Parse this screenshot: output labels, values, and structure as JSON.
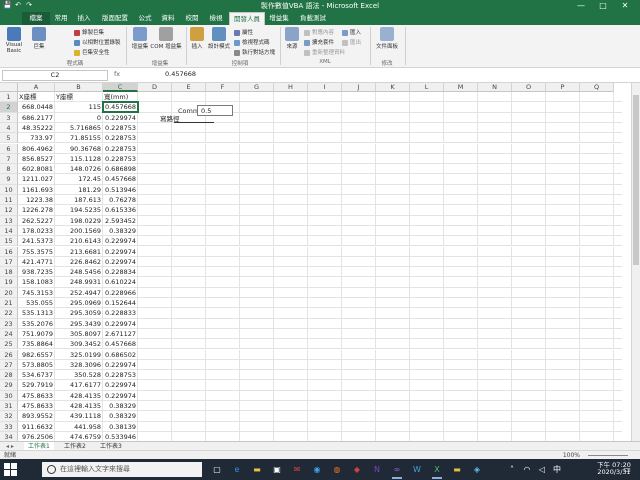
{
  "window": {
    "title": "製作數值VBA 語法 - Microsoft Excel",
    "controls": [
      "—",
      "□",
      "✕"
    ],
    "qat": [
      "💾",
      "↶",
      "↷"
    ]
  },
  "ribbon_tabs": [
    "檔案",
    "常用",
    "插入",
    "版面配置",
    "公式",
    "資料",
    "校閱",
    "檢視",
    "開發人員",
    "增益集",
    "負載測試"
  ],
  "ribbon": {
    "code_group": {
      "label": "程式碼",
      "visual_basic": "Visual Basic",
      "macros": "巨集",
      "record_macro": "錄製巨集",
      "relative_refs": "以相對位置錄製",
      "macro_security": "巨集安全性"
    },
    "addins_group": {
      "label": "增益集",
      "addins": "增益集",
      "com_addins": "COM 增益集"
    },
    "controls_group": {
      "label": "控制項",
      "insert": "插入",
      "design_mode": "設計模式",
      "properties": "屬性",
      "view_code": "檢視程式碼",
      "run_dialog": "執行對話方塊"
    },
    "xml_group": {
      "label": "XML",
      "source": "來源",
      "map_props": "對應內容",
      "expansion": "擴充套件",
      "refresh": "重新整理資料",
      "import": "匯入",
      "export": "匯出"
    },
    "modify_group": {
      "label": "修改",
      "doc_panel": "文件面板"
    }
  },
  "formula_bar": {
    "name_box": "C2",
    "fx": "fx",
    "formula": "0.457668"
  },
  "columns": [
    "A",
    "B",
    "C",
    "D",
    "E",
    "F",
    "G",
    "H",
    "I",
    "J",
    "K",
    "L",
    "M",
    "N",
    "O",
    "P",
    "Q"
  ],
  "rows": [
    {
      "n": "1",
      "a": "X座標",
      "b": "Y座標",
      "c": "寬(mm)"
    },
    {
      "n": "2",
      "a": "668.0448",
      "b": "115",
      "c": "0.457668"
    },
    {
      "n": "3",
      "a": "686.2177",
      "b": "0",
      "c": "0.229974"
    },
    {
      "n": "4",
      "a": "48.35222",
      "b": "5.716865",
      "c": "0.228753"
    },
    {
      "n": "5",
      "a": "733.97",
      "b": "71.85155",
      "c": "0.228753"
    },
    {
      "n": "6",
      "a": "806.4962",
      "b": "90.36768",
      "c": "0.228753"
    },
    {
      "n": "7",
      "a": "856.8527",
      "b": "115.1128",
      "c": "0.228753"
    },
    {
      "n": "8",
      "a": "602.8081",
      "b": "148.0726",
      "c": "0.686898"
    },
    {
      "n": "9",
      "a": "1211.027",
      "b": "172.45",
      "c": "0.457668"
    },
    {
      "n": "10",
      "a": "1161.693",
      "b": "181.29",
      "c": "0.513946"
    },
    {
      "n": "11",
      "a": "1223.38",
      "b": "187.613",
      "c": "0.76278"
    },
    {
      "n": "12",
      "a": "1226.278",
      "b": "194.5235",
      "c": "0.615336"
    },
    {
      "n": "13",
      "a": "262.5227",
      "b": "198.0229",
      "c": "2.593452"
    },
    {
      "n": "14",
      "a": "178.0233",
      "b": "200.1569",
      "c": "0.38329"
    },
    {
      "n": "15",
      "a": "241.5373",
      "b": "210.6143",
      "c": "0.229974"
    },
    {
      "n": "16",
      "a": "755.3575",
      "b": "213.6681",
      "c": "0.229974"
    },
    {
      "n": "17",
      "a": "421.4771",
      "b": "226.8462",
      "c": "0.229974"
    },
    {
      "n": "18",
      "a": "938.7235",
      "b": "248.5456",
      "c": "0.228834"
    },
    {
      "n": "19",
      "a": "158.1083",
      "b": "248.9931",
      "c": "0.610224"
    },
    {
      "n": "20",
      "a": "745.3153",
      "b": "252.4947",
      "c": "0.228966"
    },
    {
      "n": "21",
      "a": "535.055",
      "b": "295.0969",
      "c": "0.152644"
    },
    {
      "n": "22",
      "a": "535.1313",
      "b": "295.3059",
      "c": "0.228833"
    },
    {
      "n": "23",
      "a": "535.2076",
      "b": "295.3439",
      "c": "0.229974"
    },
    {
      "n": "24",
      "a": "751.9079",
      "b": "305.8097",
      "c": "2.671127"
    },
    {
      "n": "25",
      "a": "735.8864",
      "b": "309.3452",
      "c": "0.457668"
    },
    {
      "n": "26",
      "a": "982.6557",
      "b": "325.0199",
      "c": "0.686502"
    },
    {
      "n": "27",
      "a": "573.8805",
      "b": "328.3096",
      "c": "0.229974"
    },
    {
      "n": "28",
      "a": "534.6737",
      "b": "350.528",
      "c": "0.228753"
    },
    {
      "n": "29",
      "a": "529.7919",
      "b": "417.6177",
      "c": "0.229974"
    },
    {
      "n": "30",
      "a": "475.8633",
      "b": "428.4135",
      "c": "0.229974"
    },
    {
      "n": "31",
      "a": "475.8633",
      "b": "428.4135",
      "c": "0.38329"
    },
    {
      "n": "32",
      "a": "893.9552",
      "b": "439.1118",
      "c": "0.38329"
    },
    {
      "n": "33",
      "a": "911.6632",
      "b": "441.958",
      "c": "0.38139"
    },
    {
      "n": "34",
      "a": "976.2506",
      "b": "474.6759",
      "c": "0.533946"
    }
  ],
  "control": {
    "label": "Comm",
    "value": "0.5",
    "button_label": "寫路徑"
  },
  "sheet_tabs": [
    "工作表1",
    "工作表2",
    "工作表3"
  ],
  "status": {
    "left": "就緒",
    "zoom": "100%"
  },
  "taskbar": {
    "search_placeholder": "在這裡輸入文字來搜尋",
    "time": "下午 07:20",
    "date": "2020/3/31"
  },
  "colors": {
    "excel_green": "#217346",
    "taskbar": "#1f2a36"
  }
}
